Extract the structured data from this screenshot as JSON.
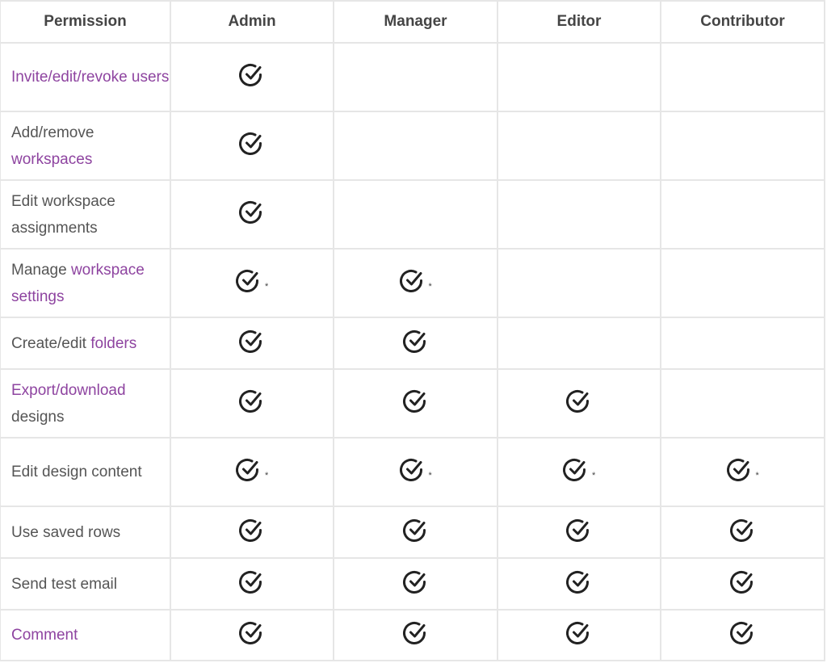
{
  "table": {
    "columns": [
      "Permission",
      "Admin",
      "Manager",
      "Editor",
      "Contributor"
    ],
    "link_color": "#8e44a0",
    "text_color": "#555555",
    "rows": [
      {
        "label": [
          {
            "text": "Invite/edit/revoke users",
            "link": true
          }
        ],
        "lines": 2,
        "cells": [
          "check",
          "",
          "",
          ""
        ]
      },
      {
        "label": [
          {
            "text": "Add/remove ",
            "link": false
          },
          {
            "text": "workspaces",
            "link": true
          }
        ],
        "lines": 2,
        "cells": [
          "check",
          "",
          "",
          ""
        ]
      },
      {
        "label": [
          {
            "text": "Edit workspace assignments",
            "link": false
          }
        ],
        "lines": 2,
        "cells": [
          "check",
          "",
          "",
          ""
        ]
      },
      {
        "label": [
          {
            "text": "Manage ",
            "link": false
          },
          {
            "text": "workspace settings",
            "link": true
          }
        ],
        "lines": 2,
        "cells": [
          "check*",
          "check*",
          "",
          ""
        ]
      },
      {
        "label": [
          {
            "text": "Create/edit ",
            "link": false
          },
          {
            "text": "folders",
            "link": true
          }
        ],
        "lines": 1,
        "cells": [
          "check",
          "check",
          "",
          ""
        ]
      },
      {
        "label": [
          {
            "text": "Export/download",
            "link": true
          },
          {
            "text": " designs",
            "link": false
          }
        ],
        "lines": 2,
        "cells": [
          "check",
          "check",
          "check",
          ""
        ]
      },
      {
        "label": [
          {
            "text": "Edit design content",
            "link": false
          }
        ],
        "lines": 2,
        "cells": [
          "check*",
          "check*",
          "check*",
          "check*"
        ]
      },
      {
        "label": [
          {
            "text": "Use saved rows",
            "link": false
          }
        ],
        "lines": 1,
        "cells": [
          "check",
          "check",
          "check",
          "check"
        ]
      },
      {
        "label": [
          {
            "text": "Send test email",
            "link": false
          }
        ],
        "lines": 1,
        "cells": [
          "check",
          "check",
          "check",
          "check"
        ]
      },
      {
        "label": [
          {
            "text": "Comment",
            "link": true
          }
        ],
        "lines": 1,
        "cells": [
          "check",
          "check",
          "check",
          "check"
        ]
      }
    ],
    "asterisk": "*",
    "check_icon": "check-circle-icon"
  }
}
